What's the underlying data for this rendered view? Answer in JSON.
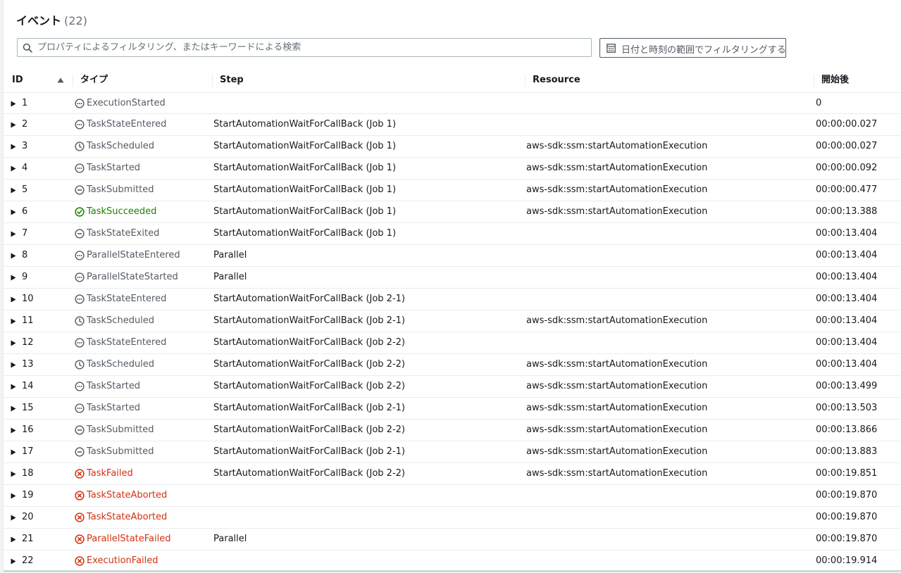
{
  "header": {
    "title": "イベント",
    "count": "(22)"
  },
  "search": {
    "placeholder": "プロパティによるフィルタリング、またはキーワードによる検索",
    "value": ""
  },
  "date_filter": {
    "label": "日付と時刻の範囲でフィルタリングする"
  },
  "columns": {
    "id": "ID",
    "type": "タイプ",
    "step": "Step",
    "resource": "Resource",
    "time": "開始後"
  },
  "status_colors": {
    "info": "#545b64",
    "success": "#1d8102",
    "error": "#d13212"
  },
  "rows": [
    {
      "id": "1",
      "icon": "ellipsis-icon",
      "status": "info",
      "type": "ExecutionStarted",
      "step": "",
      "resource": "",
      "time": "0"
    },
    {
      "id": "2",
      "icon": "ellipsis-icon",
      "status": "info",
      "type": "TaskStateEntered",
      "step": "StartAutomationWaitForCallBack (Job 1)",
      "resource": "",
      "time": "00:00:00.027"
    },
    {
      "id": "3",
      "icon": "clock-icon",
      "status": "info",
      "type": "TaskScheduled",
      "step": "StartAutomationWaitForCallBack (Job 1)",
      "resource": "aws-sdk:ssm:startAutomationExecution",
      "time": "00:00:00.027"
    },
    {
      "id": "4",
      "icon": "ellipsis-icon",
      "status": "info",
      "type": "TaskStarted",
      "step": "StartAutomationWaitForCallBack (Job 1)",
      "resource": "aws-sdk:ssm:startAutomationExecution",
      "time": "00:00:00.092"
    },
    {
      "id": "5",
      "icon": "minus-icon",
      "status": "info",
      "type": "TaskSubmitted",
      "step": "StartAutomationWaitForCallBack (Job 1)",
      "resource": "aws-sdk:ssm:startAutomationExecution",
      "time": "00:00:00.477"
    },
    {
      "id": "6",
      "icon": "check-icon",
      "status": "success",
      "type": "TaskSucceeded",
      "step": "StartAutomationWaitForCallBack (Job 1)",
      "resource": "aws-sdk:ssm:startAutomationExecution",
      "time": "00:00:13.388"
    },
    {
      "id": "7",
      "icon": "minus-icon",
      "status": "info",
      "type": "TaskStateExited",
      "step": "StartAutomationWaitForCallBack (Job 1)",
      "resource": "",
      "time": "00:00:13.404"
    },
    {
      "id": "8",
      "icon": "ellipsis-icon",
      "status": "info",
      "type": "ParallelStateEntered",
      "step": "Parallel",
      "resource": "",
      "time": "00:00:13.404"
    },
    {
      "id": "9",
      "icon": "ellipsis-icon",
      "status": "info",
      "type": "ParallelStateStarted",
      "step": "Parallel",
      "resource": "",
      "time": "00:00:13.404"
    },
    {
      "id": "10",
      "icon": "ellipsis-icon",
      "status": "info",
      "type": "TaskStateEntered",
      "step": "StartAutomationWaitForCallBack (Job 2-1)",
      "resource": "",
      "time": "00:00:13.404"
    },
    {
      "id": "11",
      "icon": "clock-icon",
      "status": "info",
      "type": "TaskScheduled",
      "step": "StartAutomationWaitForCallBack (Job 2-1)",
      "resource": "aws-sdk:ssm:startAutomationExecution",
      "time": "00:00:13.404"
    },
    {
      "id": "12",
      "icon": "ellipsis-icon",
      "status": "info",
      "type": "TaskStateEntered",
      "step": "StartAutomationWaitForCallBack (Job 2-2)",
      "resource": "",
      "time": "00:00:13.404"
    },
    {
      "id": "13",
      "icon": "clock-icon",
      "status": "info",
      "type": "TaskScheduled",
      "step": "StartAutomationWaitForCallBack (Job 2-2)",
      "resource": "aws-sdk:ssm:startAutomationExecution",
      "time": "00:00:13.404"
    },
    {
      "id": "14",
      "icon": "ellipsis-icon",
      "status": "info",
      "type": "TaskStarted",
      "step": "StartAutomationWaitForCallBack (Job 2-2)",
      "resource": "aws-sdk:ssm:startAutomationExecution",
      "time": "00:00:13.499"
    },
    {
      "id": "15",
      "icon": "ellipsis-icon",
      "status": "info",
      "type": "TaskStarted",
      "step": "StartAutomationWaitForCallBack (Job 2-1)",
      "resource": "aws-sdk:ssm:startAutomationExecution",
      "time": "00:00:13.503"
    },
    {
      "id": "16",
      "icon": "minus-icon",
      "status": "info",
      "type": "TaskSubmitted",
      "step": "StartAutomationWaitForCallBack (Job 2-2)",
      "resource": "aws-sdk:ssm:startAutomationExecution",
      "time": "00:00:13.866"
    },
    {
      "id": "17",
      "icon": "minus-icon",
      "status": "info",
      "type": "TaskSubmitted",
      "step": "StartAutomationWaitForCallBack (Job 2-1)",
      "resource": "aws-sdk:ssm:startAutomationExecution",
      "time": "00:00:13.883"
    },
    {
      "id": "18",
      "icon": "x-circle-icon",
      "status": "error",
      "type": "TaskFailed",
      "step": "StartAutomationWaitForCallBack (Job 2-2)",
      "resource": "aws-sdk:ssm:startAutomationExecution",
      "time": "00:00:19.851"
    },
    {
      "id": "19",
      "icon": "x-circle-icon",
      "status": "error",
      "type": "TaskStateAborted",
      "step": "",
      "resource": "",
      "time": "00:00:19.870"
    },
    {
      "id": "20",
      "icon": "x-circle-icon",
      "status": "error",
      "type": "TaskStateAborted",
      "step": "",
      "resource": "",
      "time": "00:00:19.870"
    },
    {
      "id": "21",
      "icon": "x-circle-icon",
      "status": "error",
      "type": "ParallelStateFailed",
      "step": "Parallel",
      "resource": "",
      "time": "00:00:19.870"
    },
    {
      "id": "22",
      "icon": "x-circle-icon",
      "status": "error",
      "type": "ExecutionFailed",
      "step": "",
      "resource": "",
      "time": "00:00:19.914"
    }
  ]
}
